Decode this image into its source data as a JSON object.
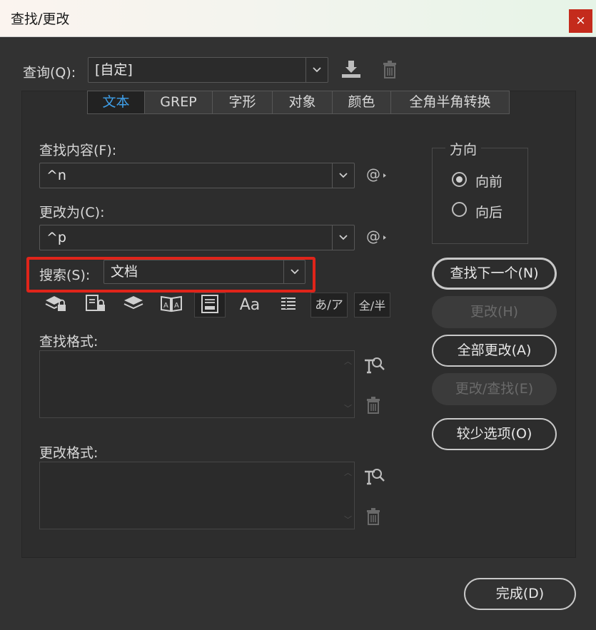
{
  "window": {
    "title": "查找/更改",
    "close_label": "×"
  },
  "query": {
    "label": "查询(Q):",
    "value": "[自定]"
  },
  "tabs": [
    {
      "label": "文本",
      "active": true
    },
    {
      "label": "GREP",
      "active": false
    },
    {
      "label": "字形",
      "active": false
    },
    {
      "label": "对象",
      "active": false
    },
    {
      "label": "颜色",
      "active": false
    },
    {
      "label": "全角半角转换",
      "active": false
    }
  ],
  "find": {
    "label": "查找内容(F):",
    "value": "^n",
    "special_char_label": "@"
  },
  "change": {
    "label": "更改为(C):",
    "value": "^p",
    "special_char_label": "@"
  },
  "search": {
    "label": "搜索(S):",
    "value": "文档"
  },
  "direction": {
    "legend": "方向",
    "options": [
      {
        "label": "向前",
        "checked": true
      },
      {
        "label": "向后",
        "checked": false
      }
    ]
  },
  "buttons": {
    "find_next": "查找下一个(N)",
    "change": "更改(H)",
    "change_all": "全部更改(A)",
    "change_find": "更改/查找(E)",
    "fewer_options": "较少选项(O)",
    "done": "完成(D)"
  },
  "option_icons": {
    "aa": "Aa",
    "kana": "あ/ア",
    "width": "全/半"
  },
  "find_format": {
    "label": "查找格式:"
  },
  "change_format": {
    "label": "更改格式:"
  },
  "colors": {
    "accent": "#3fa0ea",
    "highlight": "#e0241a",
    "close": "#c42b1c",
    "background": "#323232"
  }
}
